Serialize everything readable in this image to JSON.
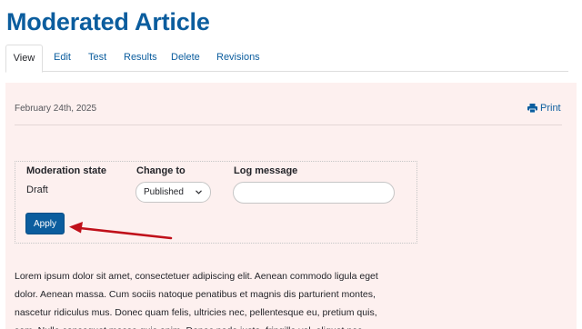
{
  "page": {
    "title": "Moderated Article"
  },
  "tabs": [
    {
      "label": "View",
      "active": true
    },
    {
      "label": "Edit",
      "active": false
    },
    {
      "label": "Test",
      "active": false
    },
    {
      "label": "Results",
      "active": false
    },
    {
      "label": "Delete",
      "active": false
    },
    {
      "label": "Revisions",
      "active": false
    }
  ],
  "article": {
    "date": "February 24th, 2025",
    "print_label": "Print",
    "body_lines": [
      "Lorem ipsum dolor sit amet, consectetuer adipiscing elit. Aenean commodo ligula eget",
      "dolor. Aenean massa. Cum sociis natoque penatibus et magnis dis parturient montes,",
      "nascetur ridiculus mus. Donec quam felis, ultricies nec, pellentesque eu, pretium quis,",
      "sem. Nulla consequat massa quis enim. Donec pede justo, fringilla vel, aliquet nec,"
    ]
  },
  "moderation": {
    "state_header": "Moderation state",
    "state_value": "Draft",
    "change_header": "Change to",
    "change_value": "Published",
    "log_header": "Log message",
    "log_value": "",
    "apply_label": "Apply"
  },
  "colors": {
    "accent": "#0b5d9e",
    "content_bg": "#fdf0ef",
    "arrow": "#c0101a"
  },
  "icons": {
    "print": "printer-icon",
    "select": "chevron-down-icon",
    "annotation": "arrow-annotation"
  }
}
